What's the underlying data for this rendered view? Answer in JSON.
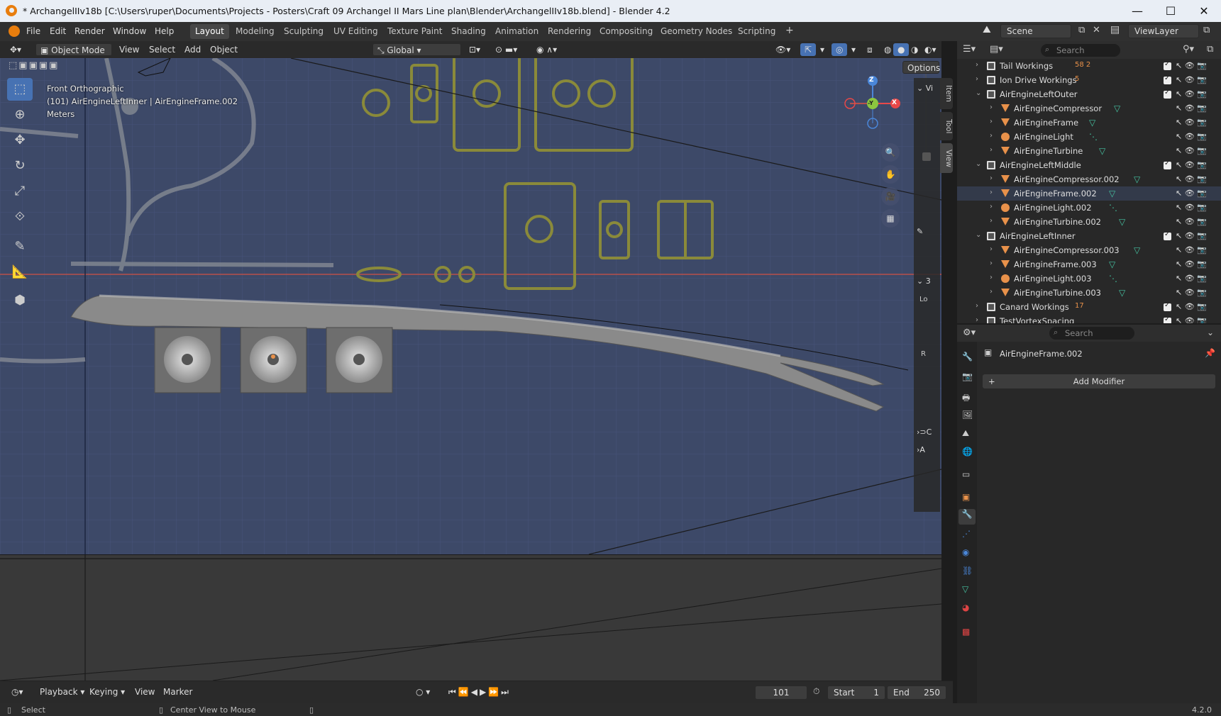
{
  "window": {
    "title": "* ArchangelIIv18b [C:\\Users\\ruper\\Documents\\Projects - Posters\\Craft 09 Archangel II Mars Line plan\\Blender\\ArchangelIIv18b.blend] - Blender 4.2",
    "min": "—",
    "max": "☐",
    "close": "✕"
  },
  "menubar": {
    "items": [
      "File",
      "Edit",
      "Render",
      "Window",
      "Help"
    ],
    "workspaces": [
      "Layout",
      "Modeling",
      "Sculpting",
      "UV Editing",
      "Texture Paint",
      "Shading",
      "Animation",
      "Rendering",
      "Compositing",
      "Geometry Nodes",
      "Scripting"
    ],
    "add_tab": "+",
    "scene": "Scene",
    "view_layer": "ViewLayer"
  },
  "viewport_header": {
    "mode": "Object Mode",
    "menus": [
      "View",
      "Select",
      "Add",
      "Object"
    ],
    "orientation": "Global",
    "options": "Options"
  },
  "viewport": {
    "view_name": "Front Orthographic",
    "object_info": "(101) AirEngineLeftInner | AirEngineFrame.002",
    "units": "Meters",
    "gizmo": {
      "z": "Z",
      "y": "-Y",
      "x": "X"
    },
    "npanel_labels": [
      "Vi",
      "3",
      "Lo",
      "R",
      "C",
      "A"
    ],
    "tabs": [
      "Item",
      "Tool",
      "View"
    ],
    "background_color": "#3d4968",
    "guide_color": "#8a8a3a"
  },
  "outliner": {
    "search_placeholder": "Search",
    "rows": [
      {
        "label": "Tail Workings",
        "type": "collection",
        "indent": 0,
        "expanded": false,
        "badge": "58 2"
      },
      {
        "label": "Ion Drive Workings",
        "type": "collection",
        "indent": 0,
        "expanded": false,
        "badge": "5"
      },
      {
        "label": "AirEngineLeftOuter",
        "type": "collection",
        "indent": 0,
        "expanded": true,
        "badge": ""
      },
      {
        "label": "AirEngineCompressor",
        "type": "mesh",
        "indent": 1,
        "expanded": false,
        "badge": ""
      },
      {
        "label": "AirEngineFrame",
        "type": "mesh",
        "indent": 1,
        "expanded": false,
        "badge": ""
      },
      {
        "label": "AirEngineLight",
        "type": "light",
        "indent": 1,
        "expanded": false,
        "badge": ""
      },
      {
        "label": "AirEngineTurbine",
        "type": "mesh",
        "indent": 1,
        "expanded": false,
        "badge": ""
      },
      {
        "label": "AirEngineLeftMiddle",
        "type": "collection",
        "indent": 0,
        "expanded": true,
        "badge": ""
      },
      {
        "label": "AirEngineCompressor.002",
        "type": "mesh",
        "indent": 1,
        "expanded": false,
        "badge": ""
      },
      {
        "label": "AirEngineFrame.002",
        "type": "mesh",
        "indent": 1,
        "expanded": false,
        "badge": ""
      },
      {
        "label": "AirEngineLight.002",
        "type": "light",
        "indent": 1,
        "expanded": false,
        "badge": ""
      },
      {
        "label": "AirEngineTurbine.002",
        "type": "mesh",
        "indent": 1,
        "expanded": false,
        "badge": ""
      },
      {
        "label": "AirEngineLeftInner",
        "type": "collection",
        "indent": 0,
        "expanded": true,
        "badge": ""
      },
      {
        "label": "AirEngineCompressor.003",
        "type": "mesh",
        "indent": 1,
        "expanded": false,
        "badge": ""
      },
      {
        "label": "AirEngineFrame.003",
        "type": "mesh",
        "indent": 1,
        "expanded": false,
        "badge": ""
      },
      {
        "label": "AirEngineLight.003",
        "type": "light",
        "indent": 1,
        "expanded": false,
        "badge": ""
      },
      {
        "label": "AirEngineTurbine.003",
        "type": "mesh",
        "indent": 1,
        "expanded": false,
        "badge": ""
      },
      {
        "label": "Canard Workings",
        "type": "collection",
        "indent": 0,
        "expanded": false,
        "badge": "17"
      },
      {
        "label": "TestVortexSpacing",
        "type": "collection",
        "indent": 0,
        "expanded": false,
        "badge": ""
      }
    ]
  },
  "properties": {
    "search_placeholder": "Search",
    "object_name": "AirEngineFrame.002",
    "add_modifier": "Add Modifier"
  },
  "timeline": {
    "menus": [
      "Playback",
      "Keying",
      "View",
      "Marker"
    ],
    "current_frame": "101",
    "start_label": "Start",
    "start": "1",
    "end_label": "End",
    "end": "250"
  },
  "statusbar": {
    "select": "Select",
    "center_view": "Center View to Mouse",
    "version": "4.2.0"
  }
}
